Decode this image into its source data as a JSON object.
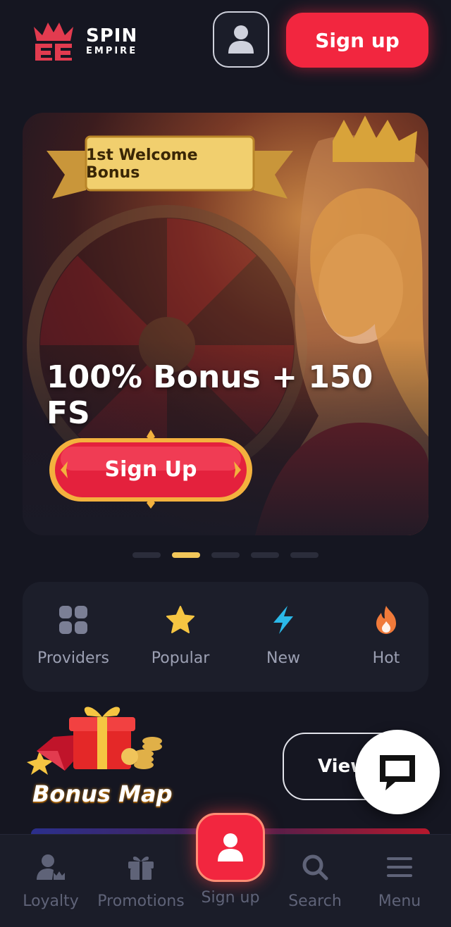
{
  "brand": {
    "name_line1": "SPIN",
    "name_line2": "EMPIRE",
    "accent": "#f2263f",
    "gold": "#f2c75a"
  },
  "header": {
    "account_icon": "user-icon",
    "signup_label": "Sign up"
  },
  "hero": {
    "ribbon": "1st Welcome Bonus",
    "title": "100% Bonus + 150 FS",
    "button_label": "Sign Up",
    "carousel": {
      "count": 5,
      "active_index": 1
    }
  },
  "categories": [
    {
      "label": "Providers",
      "icon": "grid-icon"
    },
    {
      "label": "Popular",
      "icon": "star-icon"
    },
    {
      "label": "New",
      "icon": "lightning-icon"
    },
    {
      "label": "Hot",
      "icon": "flame-icon"
    }
  ],
  "bonus_map": {
    "label": "Bonus Map",
    "view_label": "View",
    "chat_icon": "chat-bubble-icon"
  },
  "bottom_nav": [
    {
      "label": "Loyalty",
      "icon": "loyalty-icon"
    },
    {
      "label": "Promotions",
      "icon": "gift-icon"
    },
    {
      "label": "Sign up",
      "icon": "user-icon"
    },
    {
      "label": "Search",
      "icon": "search-icon"
    },
    {
      "label": "Menu",
      "icon": "menu-icon"
    }
  ]
}
